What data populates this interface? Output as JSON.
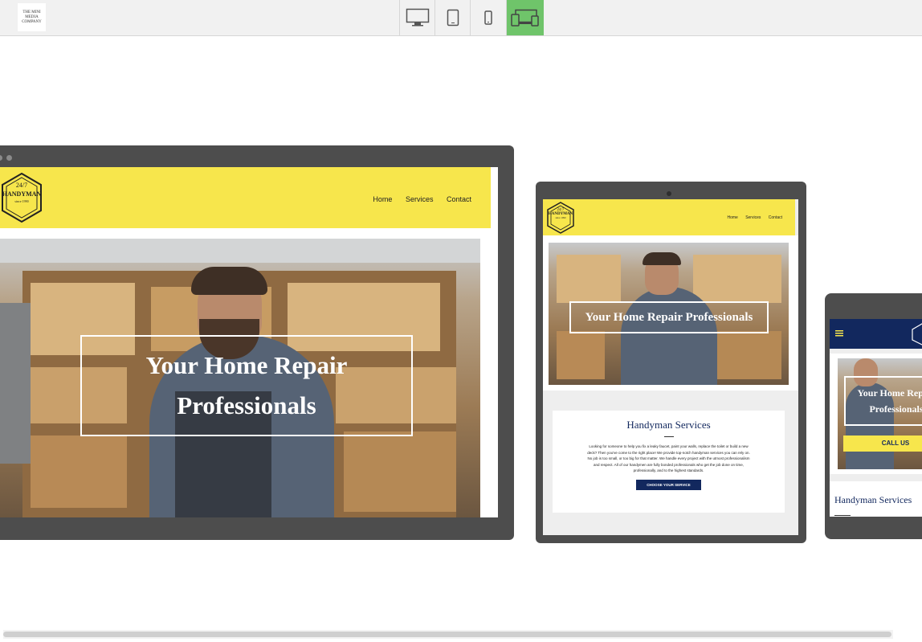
{
  "toolbar": {
    "logo_line1": "THE MINI MEDIA",
    "logo_line2": "COMPANY",
    "devices": [
      {
        "name": "desktop",
        "active": false
      },
      {
        "name": "tablet",
        "active": false
      },
      {
        "name": "mobile",
        "active": false
      },
      {
        "name": "all-devices",
        "active": true
      }
    ]
  },
  "colors": {
    "header_yellow": "#f7e64c",
    "navy": "#12285e",
    "active_green": "#6fc46a",
    "device_frame": "#4d4d4d"
  },
  "site": {
    "badge_top": "24/7",
    "badge_main": "HANDYMAN",
    "badge_since": "since 1990",
    "nav": [
      "Home",
      "Services",
      "Contact"
    ],
    "hero_title": "Your Home Repair Professionals",
    "services_title": "Handyman Services",
    "services_body": "Looking for someone to help you fix a leaky faucet, paint your walls, replace the toilet or build a new deck? Then you've come to the right place! We provide top-notch handyman services you can rely on. No job is too small, or too big for that matter. We handle every project with the utmost professionalism and respect. All of our handymen are fully bonded professionals who get the job done on time, professionally, and to the highest standards.",
    "services_button": "CHOOSE YOUR SERVICE",
    "call_button": "CALL US",
    "menu_icon": "hamburger-icon"
  }
}
